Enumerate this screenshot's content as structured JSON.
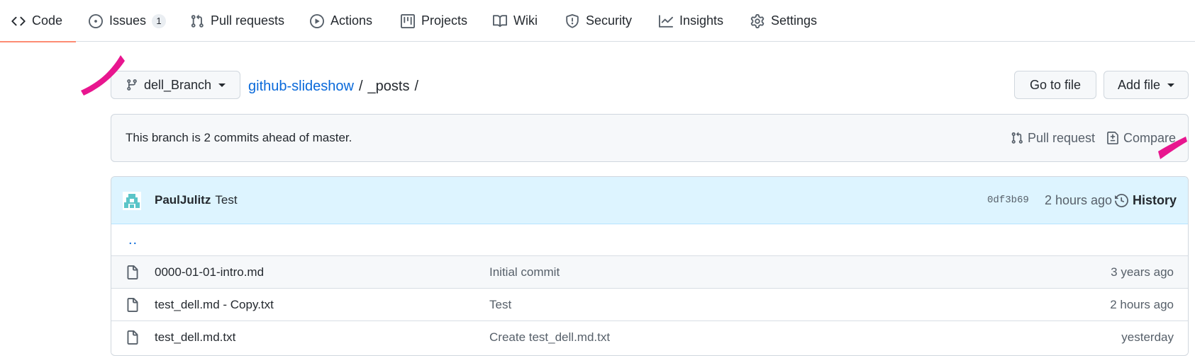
{
  "accent_colors": {
    "active_tab_underline": "#fd8c73",
    "link": "#0969da",
    "commit_bar_bg": "#ddf4ff",
    "annotation_mark": "#e8168f"
  },
  "repo_nav": {
    "tabs": [
      {
        "label": "Code",
        "icon": "code-icon",
        "active": true
      },
      {
        "label": "Issues",
        "icon": "issue-opened-icon",
        "count": "1"
      },
      {
        "label": "Pull requests",
        "icon": "git-pull-request-icon"
      },
      {
        "label": "Actions",
        "icon": "play-icon"
      },
      {
        "label": "Projects",
        "icon": "table-icon"
      },
      {
        "label": "Wiki",
        "icon": "book-icon"
      },
      {
        "label": "Security",
        "icon": "shield-icon"
      },
      {
        "label": "Insights",
        "icon": "graph-icon"
      },
      {
        "label": "Settings",
        "icon": "gear-icon"
      }
    ]
  },
  "branch_bar": {
    "branch_name": "dell_Branch",
    "breadcrumb": {
      "repo": "github-slideshow",
      "separator": "/",
      "folder": "_posts",
      "trailing_separator": "/"
    },
    "go_to_file_label": "Go to file",
    "add_file_label": "Add file"
  },
  "branch_info": {
    "text": "This branch is 2 commits ahead of master.",
    "pull_request_label": "Pull request",
    "compare_label": "Compare"
  },
  "latest_commit": {
    "author": "PaulJulitz",
    "message": "Test",
    "sha": "0df3b69",
    "age": "2 hours ago",
    "history_label": "History"
  },
  "parent_dir_link": "..",
  "files": [
    {
      "name": "0000-01-01-intro.md",
      "commit_message": "Initial commit",
      "age": "3 years ago"
    },
    {
      "name": "test_dell.md - Copy.txt",
      "commit_message": "Test",
      "age": "2 hours ago"
    },
    {
      "name": "test_dell.md.txt",
      "commit_message": "Create test_dell.md.txt",
      "age": "yesterday"
    }
  ]
}
